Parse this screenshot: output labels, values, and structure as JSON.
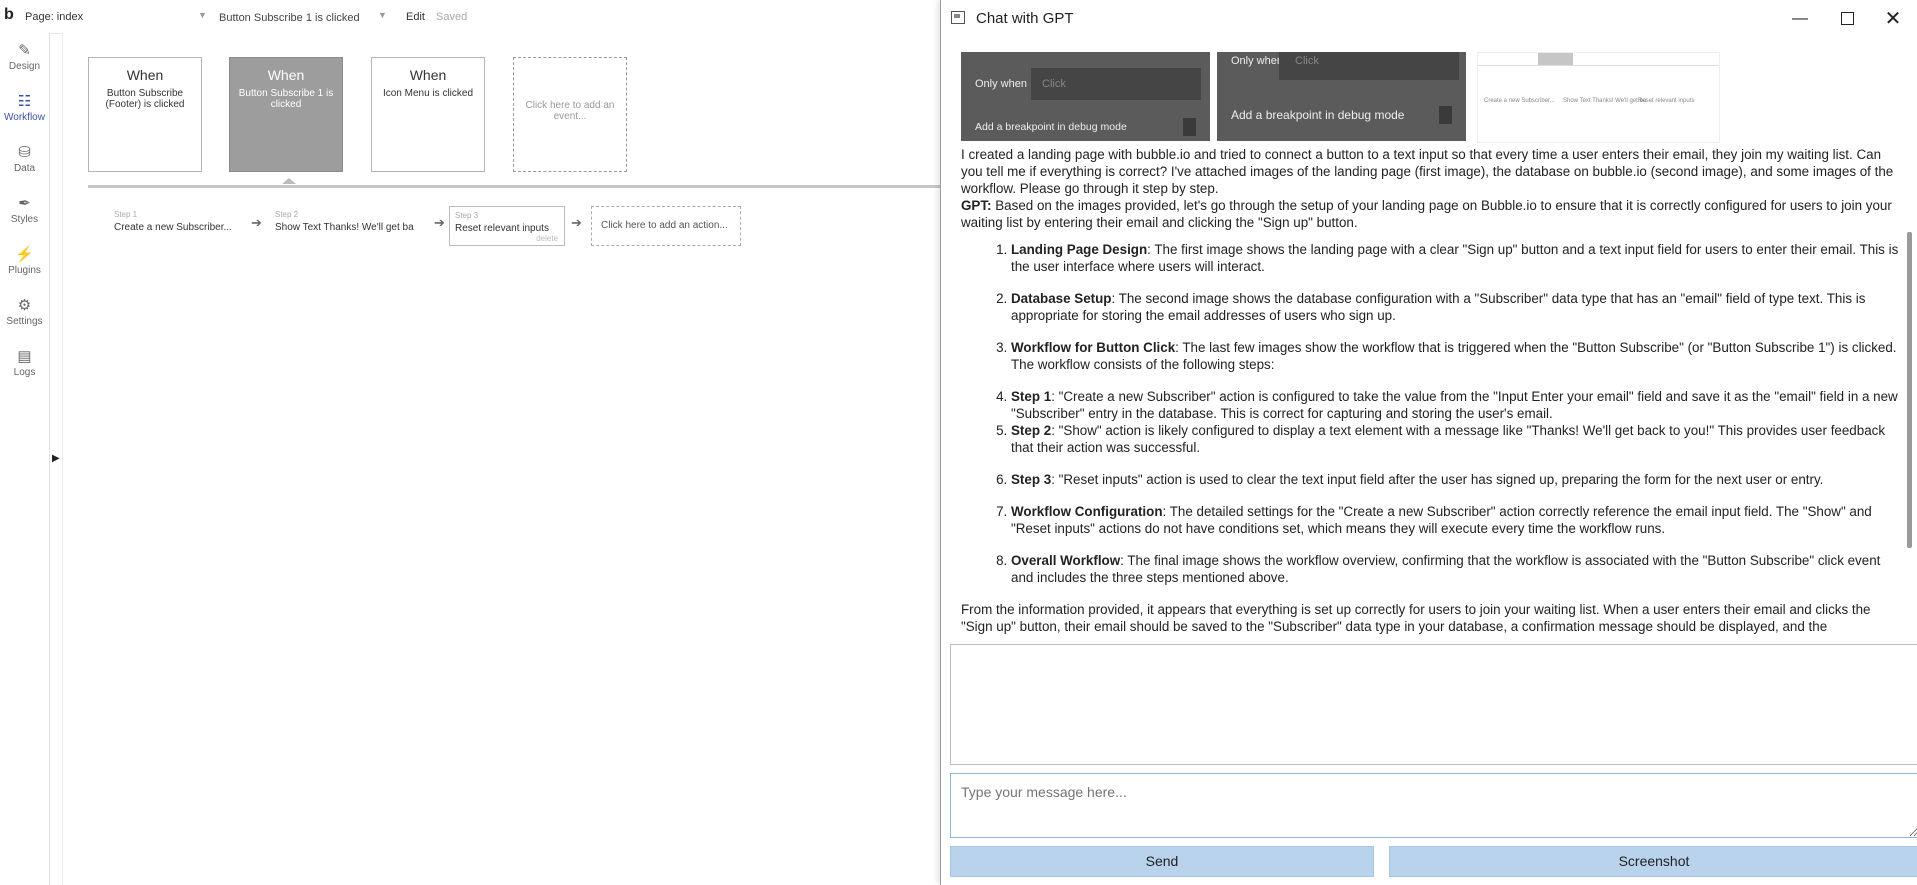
{
  "editor": {
    "logo": "b",
    "page_label": "Page: index",
    "workflow_select": "Button Subscribe 1 is clicked",
    "edit_label": "Edit",
    "saved_label": "Saved",
    "sidebar": [
      {
        "label": "Design",
        "icon": "design-icon"
      },
      {
        "label": "Workflow",
        "icon": "workflow-icon"
      },
      {
        "label": "Data",
        "icon": "database-icon"
      },
      {
        "label": "Styles",
        "icon": "brush-icon"
      },
      {
        "label": "Plugins",
        "icon": "plug-icon"
      },
      {
        "label": "Settings",
        "icon": "gear-icon"
      },
      {
        "label": "Logs",
        "icon": "document-icon"
      }
    ],
    "events": [
      {
        "when": "When",
        "label": "Button Subscribe (Footer) is clicked"
      },
      {
        "when": "When",
        "label": "Button Subscribe 1 is clicked"
      },
      {
        "when": "When",
        "label": "Icon Menu is clicked"
      }
    ],
    "add_event": "Click here to add an event...",
    "steps": [
      {
        "num": "Step 1",
        "label": "Create a new Subscriber..."
      },
      {
        "num": "Step 2",
        "label": "Show Text Thanks! We'll get ba"
      },
      {
        "num": "Step 3",
        "label": "Reset relevant inputs",
        "delete": "delete"
      }
    ],
    "add_action": "Click here to add an action..."
  },
  "chat": {
    "title": "Chat with GPT",
    "thumbs": {
      "only_when": "Only when",
      "click": "Click",
      "breakpoint": "Add a breakpoint in debug mode"
    },
    "user_message": "I created a landing page with bubble.io and tried to connect a button to a text input so that every time a user enters their email, they join my waiting list. Can you tell me if everything is correct? I've attached images of the landing page (first image), the database on bubble.io (second image), and some images of the workflow. Please go through it step by step.",
    "gpt_prefix": "GPT:",
    "gpt_intro": "Based on the images provided, let's go through the setup of your landing page on Bubble.io to ensure that it is correctly configured for users to join your waiting list by entering their email and clicking the \"Sign up\" button.",
    "items": [
      {
        "title": "Landing Page Design",
        "text": ": The first image shows the landing page with a clear \"Sign up\" button and a text input field for users to enter their email. This is the user interface where users will interact."
      },
      {
        "title": "Database Setup",
        "text": ": The second image shows the database configuration with a \"Subscriber\" data type that has an \"email\" field of type text. This is appropriate for storing the email addresses of users who sign up."
      },
      {
        "title": "Workflow for Button Click",
        "text": ": The last few images show the workflow that is triggered when the \"Button Subscribe\" (or \"Button Subscribe 1\") is clicked. The workflow consists of the following steps:"
      },
      {
        "title": "Step 1",
        "text": ": \"Create a new Subscriber\" action is configured to take the value from the \"Input Enter your email\" field and save it as the \"email\" field in a new \"Subscriber\" entry in the database. This is correct for capturing and storing the user's email."
      },
      {
        "title": "Step 2",
        "text": ": \"Show\" action is likely configured to display a text element with a message like \"Thanks! We'll get back to you!\" This provides user feedback that their action was successful."
      },
      {
        "title": "Step 3",
        "text": ": \"Reset inputs\" action is used to clear the text input field after the user has signed up, preparing the form for the next user or entry."
      },
      {
        "title": "Workflow Configuration",
        "text": ": The detailed settings for the \"Create a new Subscriber\" action correctly reference the email input field. The \"Show\" and \"Reset inputs\" actions do not have conditions set, which means they will execute every time the workflow runs."
      },
      {
        "title": "Overall Workflow",
        "text": ": The final image shows the workflow overview, confirming that the workflow is associated with the \"Button Subscribe\" click event and includes the three steps mentioned above."
      }
    ],
    "conclusion": "From the information provided, it appears that everything is set up correctly for users to join your waiting list. When a user enters their email and clicks the \"Sign up\" button, their email should be saved to the \"Subscriber\" data type in your database, a confirmation message should be displayed, and the",
    "input_placeholder": "Type your message here...",
    "send_label": "Send",
    "screenshot_label": "Screenshot"
  }
}
